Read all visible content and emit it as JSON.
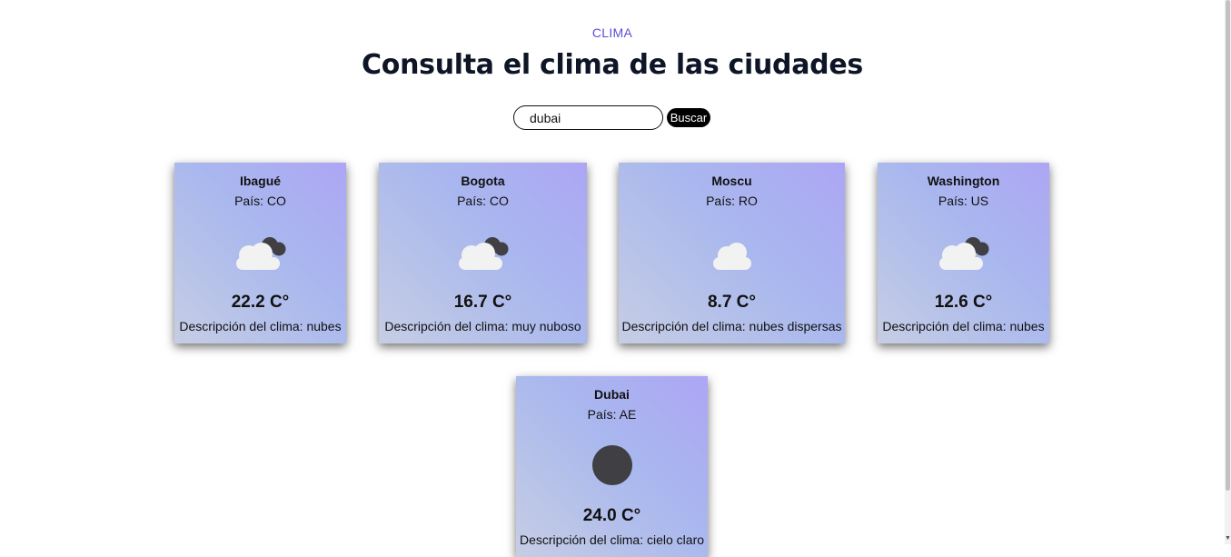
{
  "header": {
    "eyebrow": "CLIMA",
    "title": "Consulta el clima de las ciudades"
  },
  "search": {
    "value": "dubai",
    "button_label": "Buscar"
  },
  "cards": [
    {
      "city": "Ibagué",
      "country": "País: CO",
      "icon": "cloudy-icon",
      "temp": "22.2 C°",
      "desc": "Descripción del clima: nubes"
    },
    {
      "city": "Bogota",
      "country": "País: CO",
      "icon": "cloudy-icon",
      "temp": "16.7 C°",
      "desc": "Descripción del clima: muy nuboso"
    },
    {
      "city": "Moscu",
      "country": "País: RO",
      "icon": "cloud-icon",
      "temp": "8.7 C°",
      "desc": "Descripción del clima: nubes dispersas"
    },
    {
      "city": "Washington",
      "country": "País: US",
      "icon": "cloudy-icon",
      "temp": "12.6 C°",
      "desc": "Descripción del clima: nubes"
    },
    {
      "city": "Dubai",
      "country": "País: AE",
      "icon": "clear-sky-icon",
      "temp": "24.0 C°",
      "desc": "Descripción del clima: cielo claro"
    }
  ],
  "colors": {
    "accent": "#5b4fd6",
    "title": "#0d1526",
    "card_gradient_start": "#c6cde4",
    "card_gradient_end": "#aca6f4",
    "cloud_light": "#f2f2f2",
    "cloud_dark": "#3f3f44"
  }
}
